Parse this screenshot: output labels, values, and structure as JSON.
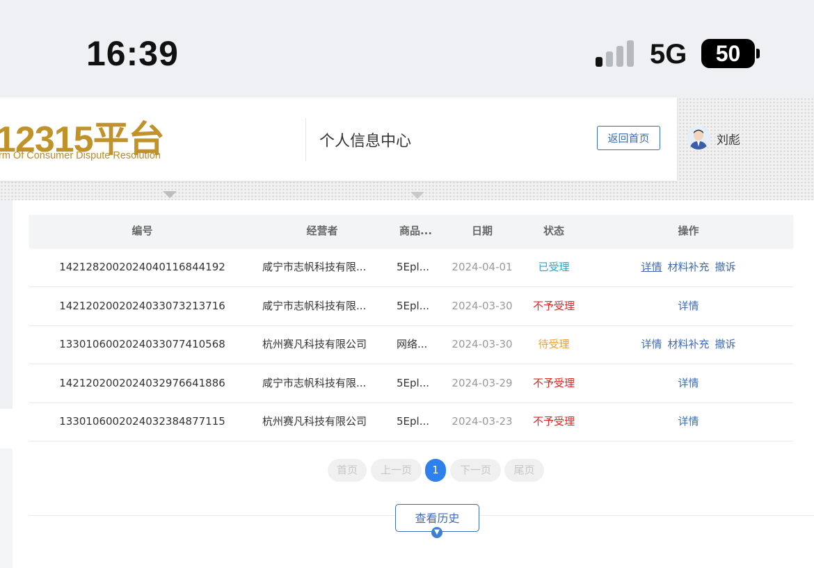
{
  "status_bar": {
    "time": "16:39",
    "network": "5G",
    "battery": "50"
  },
  "header": {
    "logo_main": "12315平台",
    "logo_sub": "rm Of Consumer Dispute Resolution",
    "page_title": "个人信息中心",
    "home_button": "返回首页",
    "user_name": "刘彪",
    "avatar_icon": "user-avatar-icon"
  },
  "table": {
    "columns": [
      "编号",
      "经营者",
      "商品...",
      "日期",
      "状态",
      "操作"
    ],
    "rows": [
      {
        "id": "1421282002024040116844192",
        "business": "咸宁市志帆科技有限...",
        "goods": "5Epl...",
        "date": "2024-04-01",
        "status": "已受理",
        "ops": [
          "详情",
          "材料补充",
          "撤诉"
        ]
      },
      {
        "id": "1421202002024033073213716",
        "business": "咸宁市志帆科技有限...",
        "goods": "5Epl...",
        "date": "2024-03-30",
        "status": "不予受理",
        "ops": [
          "详情"
        ]
      },
      {
        "id": "1330106002024033077410568",
        "business": "杭州赛凡科技有限公司",
        "goods": "网络...",
        "date": "2024-03-30",
        "status": "待受理",
        "ops": [
          "详情",
          "材料补充",
          "撤诉"
        ]
      },
      {
        "id": "1421202002024032976641886",
        "business": "咸宁市志帆科技有限...",
        "goods": "5Epl...",
        "date": "2024-03-29",
        "status": "不予受理",
        "ops": [
          "详情"
        ]
      },
      {
        "id": "1330106002024032384877115",
        "business": "杭州赛凡科技有限公司",
        "goods": "5Epl...",
        "date": "2024-03-23",
        "status": "不予受理",
        "ops": [
          "详情"
        ]
      }
    ]
  },
  "status_colors": {
    "已受理": "#2aa7c9",
    "不予受理": "#e02424",
    "待受理": "#e8a33a"
  },
  "pagination": {
    "first": "首页",
    "prev": "上一页",
    "current": "1",
    "next": "下一页",
    "last": "尾页"
  },
  "history_button": "查看历史"
}
